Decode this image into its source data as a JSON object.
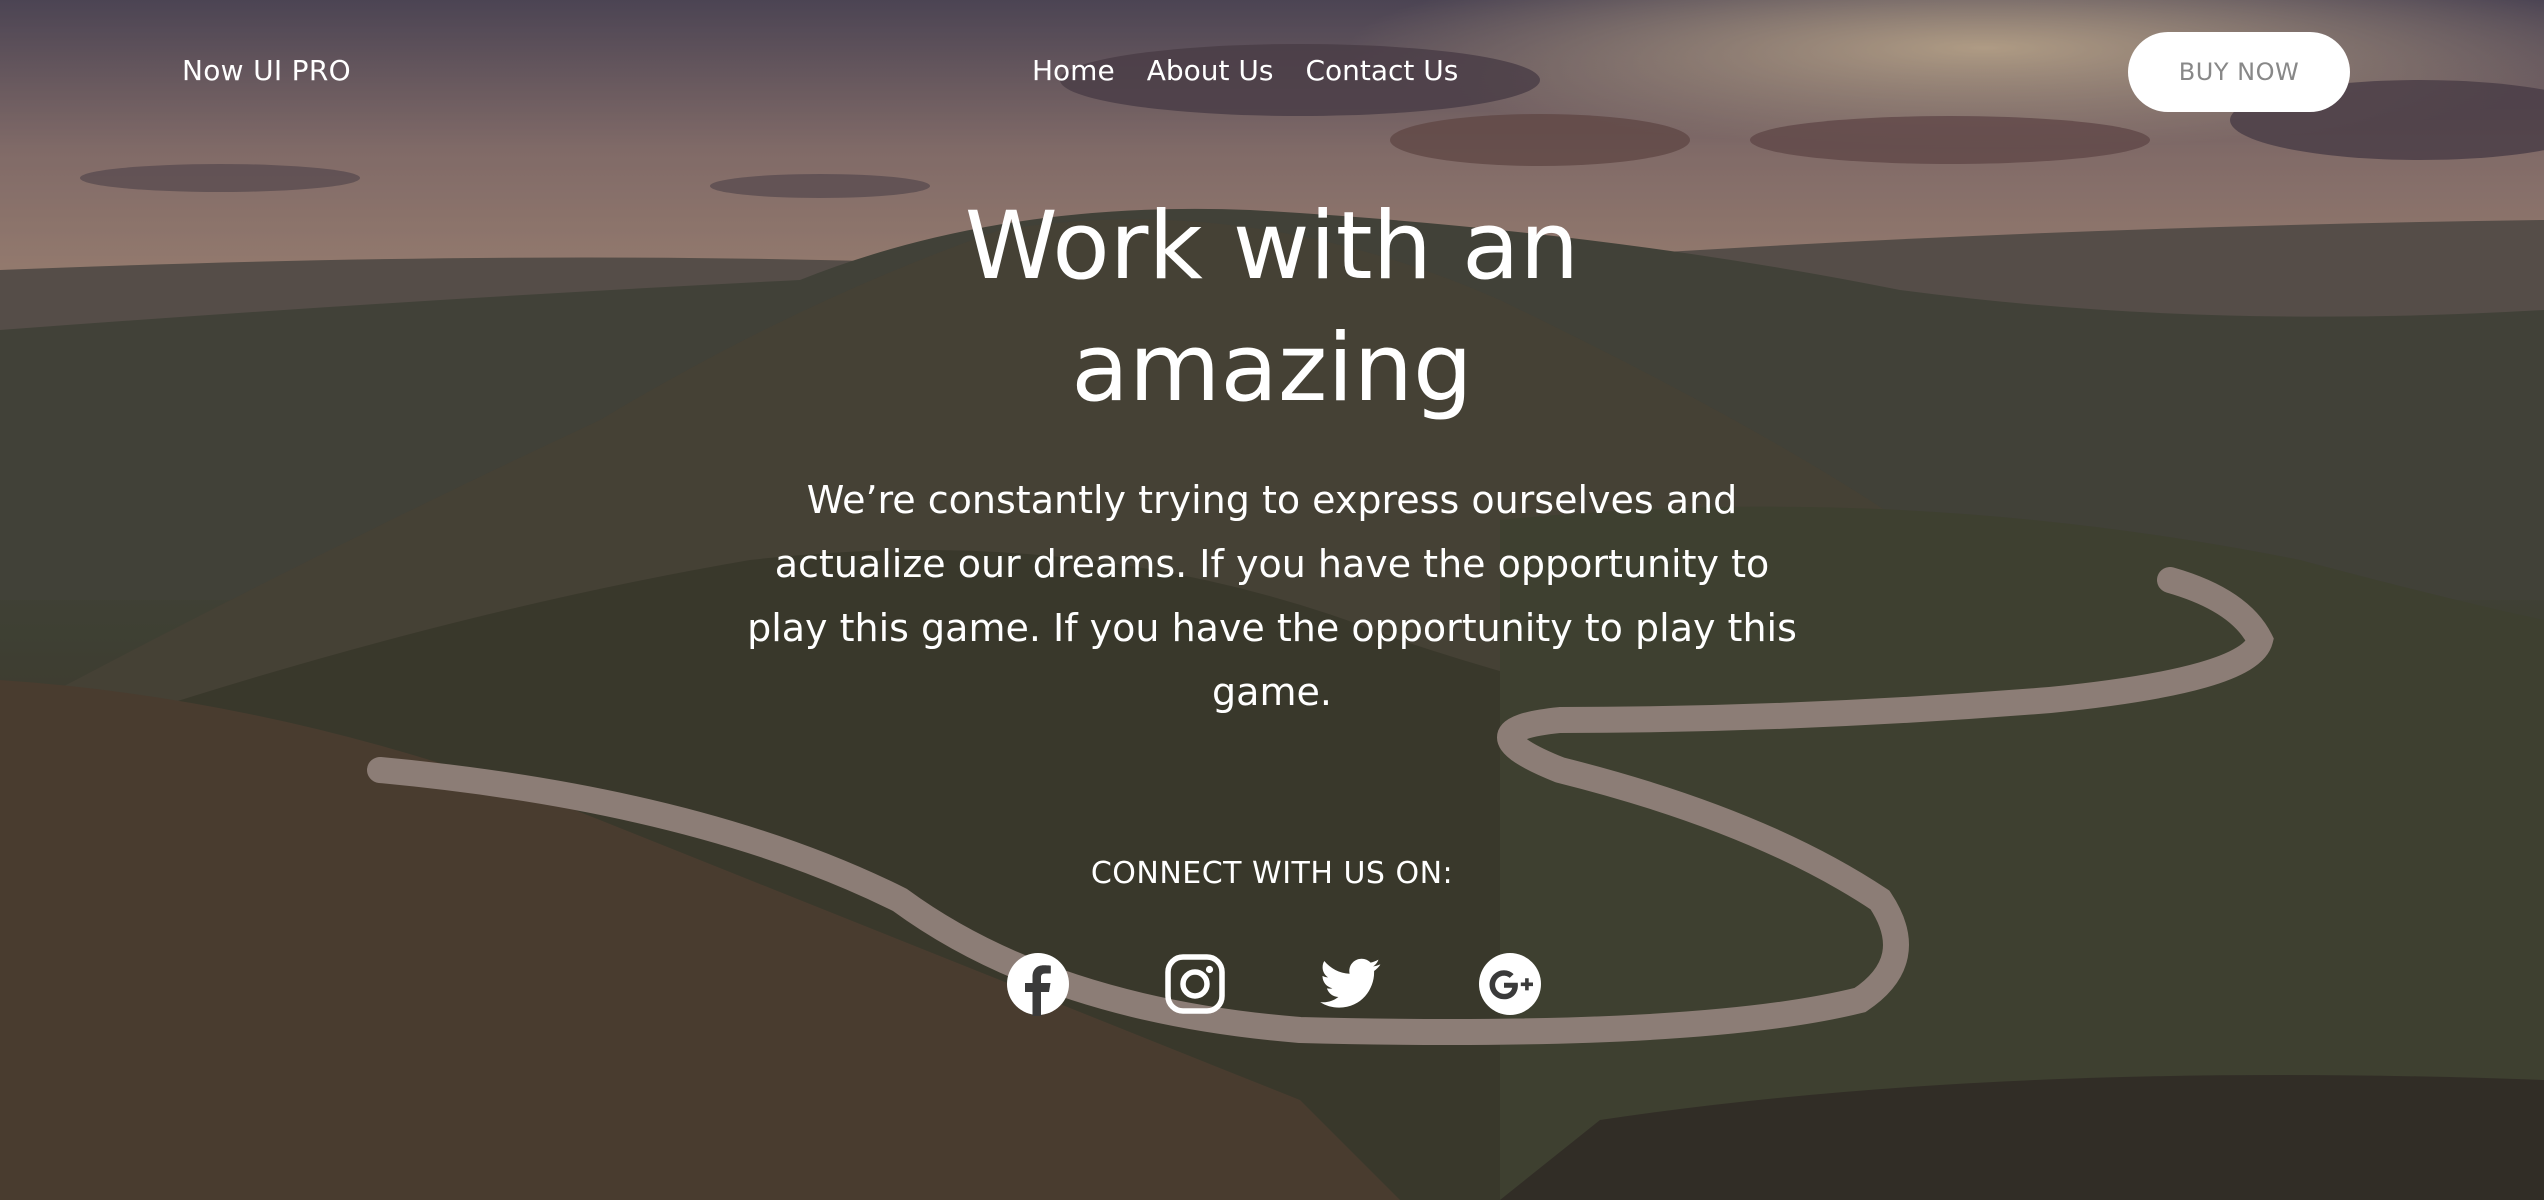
{
  "brand": "Now UI PRO",
  "nav": {
    "home": "Home",
    "about": "About Us",
    "contact": "Contact Us"
  },
  "buy_button": "BUY NOW",
  "hero": {
    "title_line1": "Work with an",
    "title_line2": "amazing",
    "description": "We’re constantly trying to express ourselves and actualize our dreams. If you have the opportunity to play this game. If you have the opportunity to play this game.",
    "connect_label": "CONNECT WITH US ON:"
  },
  "social_icons": [
    "facebook-icon",
    "instagram-icon",
    "twitter-icon",
    "google-plus-icon"
  ],
  "colors": {
    "button_bg": "#ffffff",
    "button_text": "#888888",
    "text": "#ffffff"
  }
}
